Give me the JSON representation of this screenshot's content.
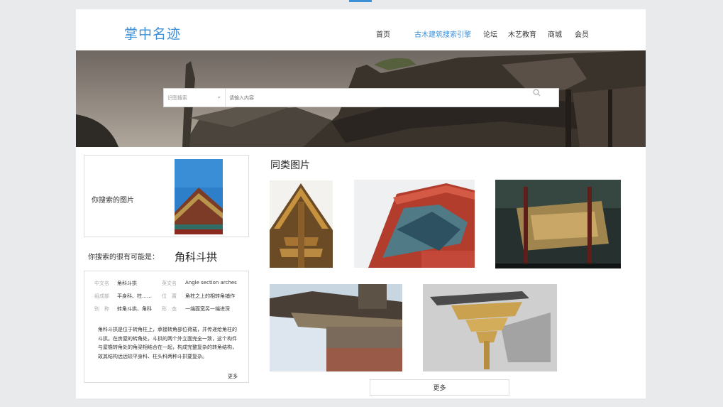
{
  "header": {
    "logo": "掌中名迹",
    "nav": [
      {
        "label": "首页"
      },
      {
        "label": "古木建筑搜索引擎"
      },
      {
        "label": "论坛"
      },
      {
        "label": "木艺教育"
      },
      {
        "label": "商城"
      },
      {
        "label": "会员"
      }
    ],
    "accent_color": "#3d8fd6"
  },
  "search": {
    "select_value": "识图搜索",
    "placeholder": "请输入内容",
    "icon": "search-icon"
  },
  "query": {
    "label": "你搜索的图片",
    "maybe_label": "你搜索的很有可能是：",
    "maybe_value": "角科斗拱"
  },
  "info": {
    "rows": [
      {
        "k1": "中文名",
        "v1": "角科斗拱",
        "k2": "英文名",
        "v2": "Angle section arches"
      },
      {
        "k1": "组成部",
        "v1": "平身科、柱……",
        "k2": "位　置",
        "v2": "角柱之上的相转角铺作"
      },
      {
        "k1": "别　称",
        "v1": "转角斗拱、角科",
        "k2": "形　态",
        "v2": "一端面宽另一端进深"
      }
    ],
    "description": "角科斗拱是位于转角柱上，承接转角部位荷载，并传递给角柱的斗拱。在房屋的转角处，斗拱的两个外立面完全一致，这个构件与屋檐转角处的角梁相结合在一起，构成完整复杂的转角结构，故其结构远远较平身科、柱头科两种斗拱要复杂。",
    "more": "更多"
  },
  "similar": {
    "title": "同类图片",
    "more": "更多"
  }
}
